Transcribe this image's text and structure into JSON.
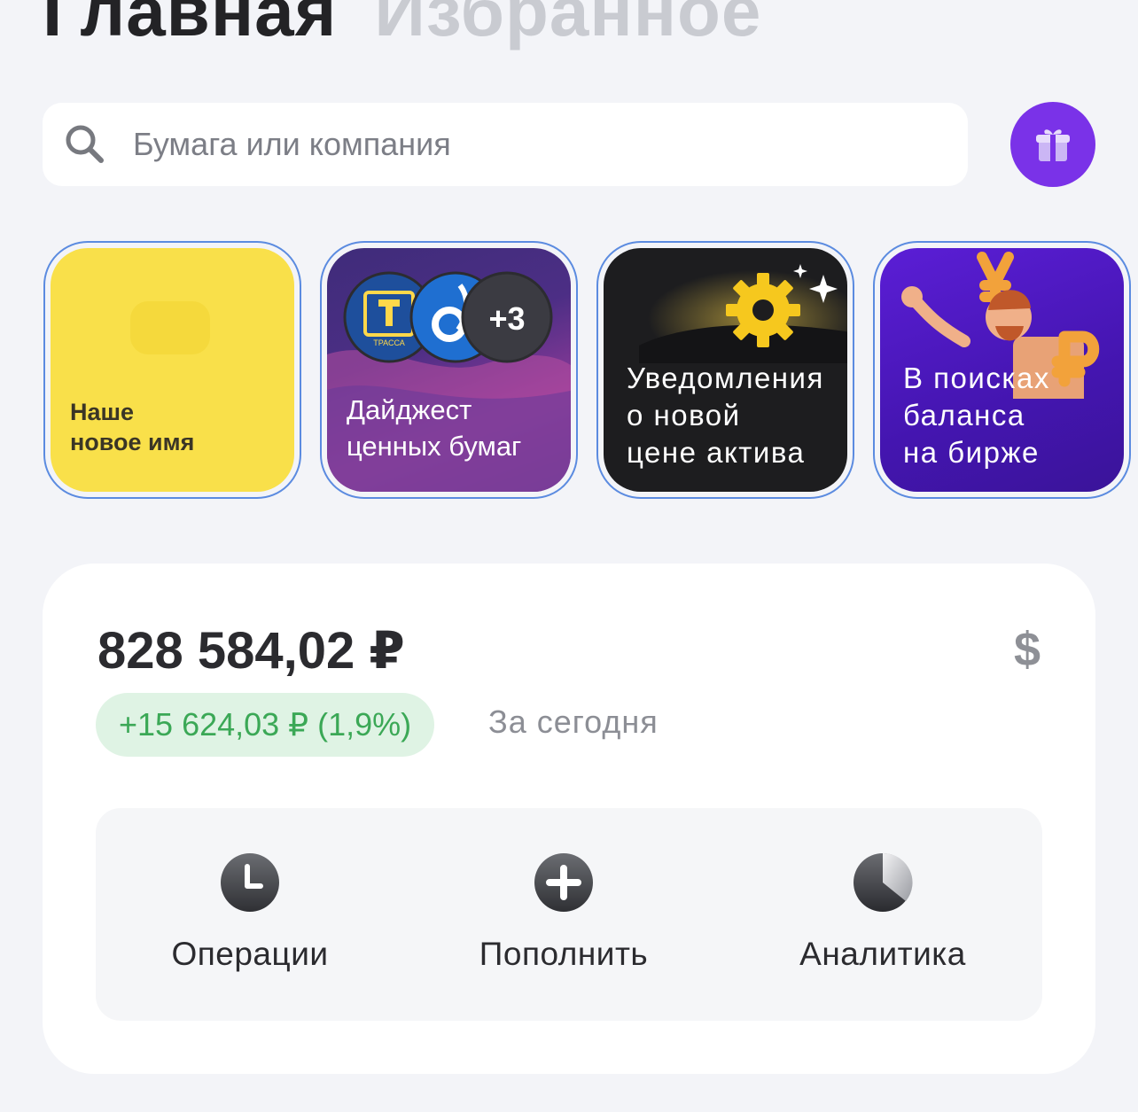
{
  "tabs": [
    {
      "label": "Главная",
      "active": true
    },
    {
      "label": "Избранное",
      "active": false
    }
  ],
  "search": {
    "placeholder": "Бумага или компания",
    "icon": "search-icon"
  },
  "gift_button": {
    "icon": "gift-icon",
    "color": "#7a32e8"
  },
  "stories": [
    {
      "text": "Наше\nновое имя"
    },
    {
      "text": "Дайджест\nценных бумаг",
      "badge": "+3",
      "badge_icon_1_text": "ТРАССА"
    },
    {
      "text": "Уведомления\nо новой\nцене актива"
    },
    {
      "text": "В поисках\nбаланса\nна бирже"
    }
  ],
  "portfolio": {
    "balance": "828 584,02 ₽",
    "currency_toggle": "$",
    "change": "+15 624,03 ₽ (1,9%)",
    "period": "За сегодня",
    "change_color": "#3ba856"
  },
  "actions": [
    {
      "label": "Операции",
      "icon": "clock-icon"
    },
    {
      "label": "Пополнить",
      "icon": "plus-circle-icon"
    },
    {
      "label": "Аналитика",
      "icon": "pie-chart-icon"
    }
  ]
}
